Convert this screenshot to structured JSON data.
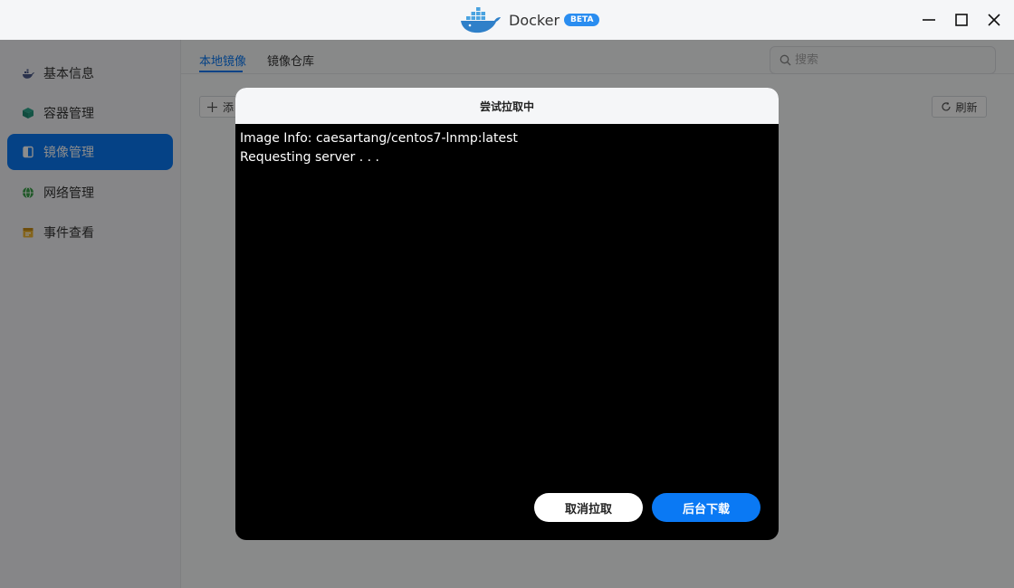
{
  "app": {
    "title": "Docker",
    "badge": "BETA"
  },
  "sidebar": {
    "items": [
      {
        "label": "基本信息",
        "icon": "whale-icon"
      },
      {
        "label": "容器管理",
        "icon": "cube-icon"
      },
      {
        "label": "镜像管理",
        "icon": "image-icon",
        "active": true
      },
      {
        "label": "网络管理",
        "icon": "globe-icon"
      },
      {
        "label": "事件查看",
        "icon": "calendar-icon"
      }
    ]
  },
  "main": {
    "tabs": [
      {
        "label": "本地镜像",
        "active": true
      },
      {
        "label": "镜像仓库"
      }
    ],
    "search": {
      "placeholder": "搜索",
      "value": ""
    },
    "add_label": "添",
    "refresh_label": "刷新"
  },
  "dialog": {
    "title": "尝试拉取中",
    "log_lines": [
      "Image Info: caesartang/centos7-lnmp:latest",
      "Requesting server . . ."
    ],
    "cancel_label": "取消拉取",
    "background_label": "后台下载"
  },
  "colors": {
    "accent": "#0a79f4",
    "beta": "#2a8df0"
  }
}
